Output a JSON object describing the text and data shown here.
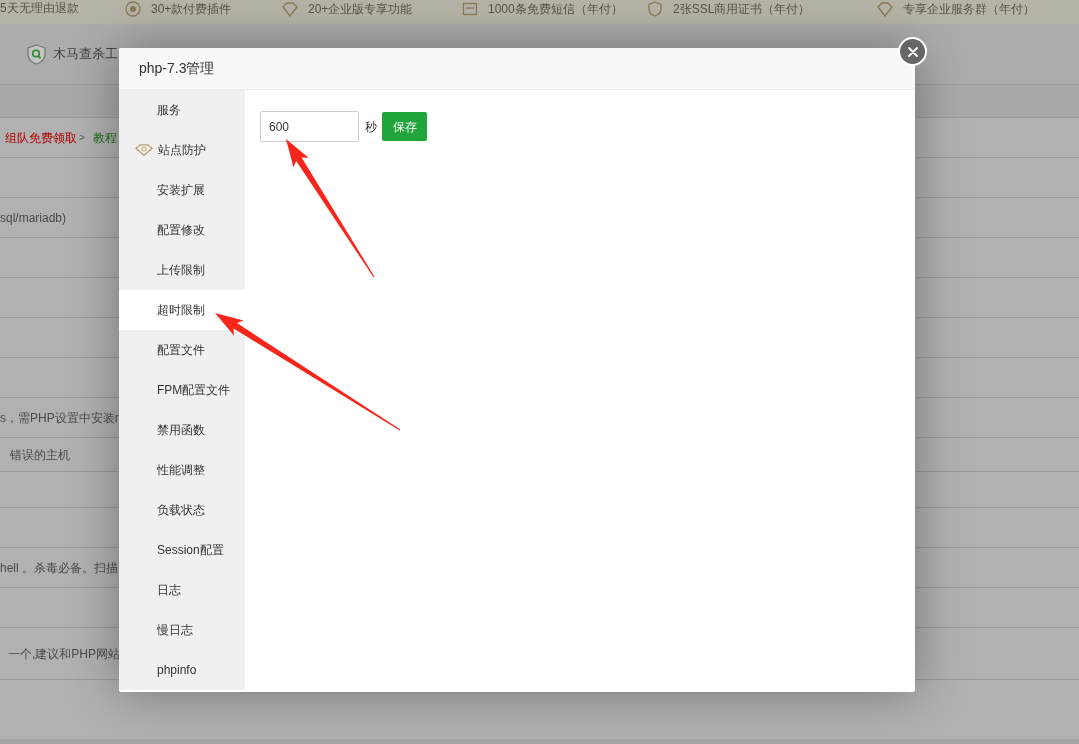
{
  "promo_bar": {
    "items": [
      {
        "kind": "text",
        "label": "5天无理由退款"
      },
      {
        "kind": "badge",
        "label": "30+款付费插件"
      },
      {
        "kind": "diamond",
        "label": "20+企业版专享功能"
      },
      {
        "kind": "message",
        "label": "1000条免费短信（年付）"
      },
      {
        "kind": "ssl",
        "label": "2张SSL商用证书（年付）"
      },
      {
        "kind": "diamond",
        "label": "专享企业服务群（年付）"
      }
    ]
  },
  "page": {
    "tool": {
      "label": "木马查杀工"
    },
    "rows": [
      {
        "parts": [
          {
            "kind": "link",
            "text": "组队免费领取",
            "color": "#b00000"
          },
          {
            "kind": "separator",
            "text": ">"
          },
          {
            "kind": "link",
            "text": "教程",
            "color": "#1d6e1d"
          }
        ]
      },
      {
        "text": "sql/mariadb)"
      },
      {
        "text": "s，需PHP设置中安装r"
      },
      {
        "text": "错误的主机"
      },
      {
        "text": "hell 。杀毒必备。扫描"
      },
      {
        "text": "一个,建议和PHP网站"
      }
    ]
  },
  "dialog": {
    "title": "php-7.3管理",
    "menu": [
      {
        "label": "服务",
        "kind": "plain",
        "selected": false
      },
      {
        "label": "站点防护",
        "kind": "premium",
        "selected": false
      },
      {
        "label": "安装扩展",
        "kind": "plain",
        "selected": false
      },
      {
        "label": "配置修改",
        "kind": "plain",
        "selected": false
      },
      {
        "label": "上传限制",
        "kind": "plain",
        "selected": false
      },
      {
        "label": "超时限制",
        "kind": "plain",
        "selected": true
      },
      {
        "label": "配置文件",
        "kind": "plain",
        "selected": false
      },
      {
        "label": "FPM配置文件",
        "kind": "plain",
        "selected": false
      },
      {
        "label": "禁用函数",
        "kind": "plain",
        "selected": false
      },
      {
        "label": "性能调整",
        "kind": "plain",
        "selected": false
      },
      {
        "label": "负载状态",
        "kind": "plain",
        "selected": false
      },
      {
        "label": "Session配置",
        "kind": "plain",
        "selected": false
      },
      {
        "label": "日志",
        "kind": "plain",
        "selected": false
      },
      {
        "label": "慢日志",
        "kind": "plain",
        "selected": false
      },
      {
        "label": "phpinfo",
        "kind": "plain",
        "selected": false
      }
    ],
    "form": {
      "value": "600",
      "unit": "秒",
      "save": "保存"
    }
  }
}
